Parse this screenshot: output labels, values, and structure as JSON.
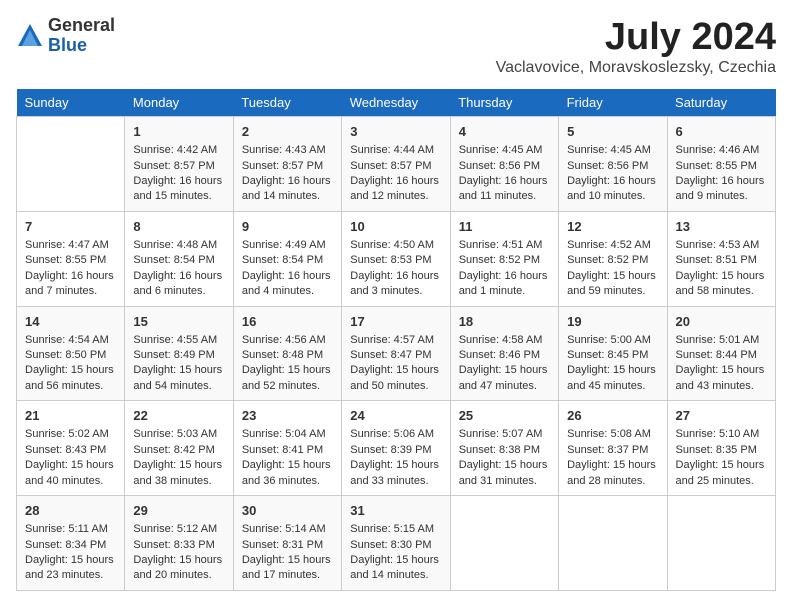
{
  "logo": {
    "general": "General",
    "blue": "Blue"
  },
  "title": "July 2024",
  "subtitle": "Vaclavovice, Moravskoslezsky, Czechia",
  "days_of_week": [
    "Sunday",
    "Monday",
    "Tuesday",
    "Wednesday",
    "Thursday",
    "Friday",
    "Saturday"
  ],
  "weeks": [
    [
      {
        "day": "",
        "info": ""
      },
      {
        "day": "1",
        "info": "Sunrise: 4:42 AM\nSunset: 8:57 PM\nDaylight: 16 hours and 15 minutes."
      },
      {
        "day": "2",
        "info": "Sunrise: 4:43 AM\nSunset: 8:57 PM\nDaylight: 16 hours and 14 minutes."
      },
      {
        "day": "3",
        "info": "Sunrise: 4:44 AM\nSunset: 8:57 PM\nDaylight: 16 hours and 12 minutes."
      },
      {
        "day": "4",
        "info": "Sunrise: 4:45 AM\nSunset: 8:56 PM\nDaylight: 16 hours and 11 minutes."
      },
      {
        "day": "5",
        "info": "Sunrise: 4:45 AM\nSunset: 8:56 PM\nDaylight: 16 hours and 10 minutes."
      },
      {
        "day": "6",
        "info": "Sunrise: 4:46 AM\nSunset: 8:55 PM\nDaylight: 16 hours and 9 minutes."
      }
    ],
    [
      {
        "day": "7",
        "info": "Sunrise: 4:47 AM\nSunset: 8:55 PM\nDaylight: 16 hours and 7 minutes."
      },
      {
        "day": "8",
        "info": "Sunrise: 4:48 AM\nSunset: 8:54 PM\nDaylight: 16 hours and 6 minutes."
      },
      {
        "day": "9",
        "info": "Sunrise: 4:49 AM\nSunset: 8:54 PM\nDaylight: 16 hours and 4 minutes."
      },
      {
        "day": "10",
        "info": "Sunrise: 4:50 AM\nSunset: 8:53 PM\nDaylight: 16 hours and 3 minutes."
      },
      {
        "day": "11",
        "info": "Sunrise: 4:51 AM\nSunset: 8:52 PM\nDaylight: 16 hours and 1 minute."
      },
      {
        "day": "12",
        "info": "Sunrise: 4:52 AM\nSunset: 8:52 PM\nDaylight: 15 hours and 59 minutes."
      },
      {
        "day": "13",
        "info": "Sunrise: 4:53 AM\nSunset: 8:51 PM\nDaylight: 15 hours and 58 minutes."
      }
    ],
    [
      {
        "day": "14",
        "info": "Sunrise: 4:54 AM\nSunset: 8:50 PM\nDaylight: 15 hours and 56 minutes."
      },
      {
        "day": "15",
        "info": "Sunrise: 4:55 AM\nSunset: 8:49 PM\nDaylight: 15 hours and 54 minutes."
      },
      {
        "day": "16",
        "info": "Sunrise: 4:56 AM\nSunset: 8:48 PM\nDaylight: 15 hours and 52 minutes."
      },
      {
        "day": "17",
        "info": "Sunrise: 4:57 AM\nSunset: 8:47 PM\nDaylight: 15 hours and 50 minutes."
      },
      {
        "day": "18",
        "info": "Sunrise: 4:58 AM\nSunset: 8:46 PM\nDaylight: 15 hours and 47 minutes."
      },
      {
        "day": "19",
        "info": "Sunrise: 5:00 AM\nSunset: 8:45 PM\nDaylight: 15 hours and 45 minutes."
      },
      {
        "day": "20",
        "info": "Sunrise: 5:01 AM\nSunset: 8:44 PM\nDaylight: 15 hours and 43 minutes."
      }
    ],
    [
      {
        "day": "21",
        "info": "Sunrise: 5:02 AM\nSunset: 8:43 PM\nDaylight: 15 hours and 40 minutes."
      },
      {
        "day": "22",
        "info": "Sunrise: 5:03 AM\nSunset: 8:42 PM\nDaylight: 15 hours and 38 minutes."
      },
      {
        "day": "23",
        "info": "Sunrise: 5:04 AM\nSunset: 8:41 PM\nDaylight: 15 hours and 36 minutes."
      },
      {
        "day": "24",
        "info": "Sunrise: 5:06 AM\nSunset: 8:39 PM\nDaylight: 15 hours and 33 minutes."
      },
      {
        "day": "25",
        "info": "Sunrise: 5:07 AM\nSunset: 8:38 PM\nDaylight: 15 hours and 31 minutes."
      },
      {
        "day": "26",
        "info": "Sunrise: 5:08 AM\nSunset: 8:37 PM\nDaylight: 15 hours and 28 minutes."
      },
      {
        "day": "27",
        "info": "Sunrise: 5:10 AM\nSunset: 8:35 PM\nDaylight: 15 hours and 25 minutes."
      }
    ],
    [
      {
        "day": "28",
        "info": "Sunrise: 5:11 AM\nSunset: 8:34 PM\nDaylight: 15 hours and 23 minutes."
      },
      {
        "day": "29",
        "info": "Sunrise: 5:12 AM\nSunset: 8:33 PM\nDaylight: 15 hours and 20 minutes."
      },
      {
        "day": "30",
        "info": "Sunrise: 5:14 AM\nSunset: 8:31 PM\nDaylight: 15 hours and 17 minutes."
      },
      {
        "day": "31",
        "info": "Sunrise: 5:15 AM\nSunset: 8:30 PM\nDaylight: 15 hours and 14 minutes."
      },
      {
        "day": "",
        "info": ""
      },
      {
        "day": "",
        "info": ""
      },
      {
        "day": "",
        "info": ""
      }
    ]
  ]
}
